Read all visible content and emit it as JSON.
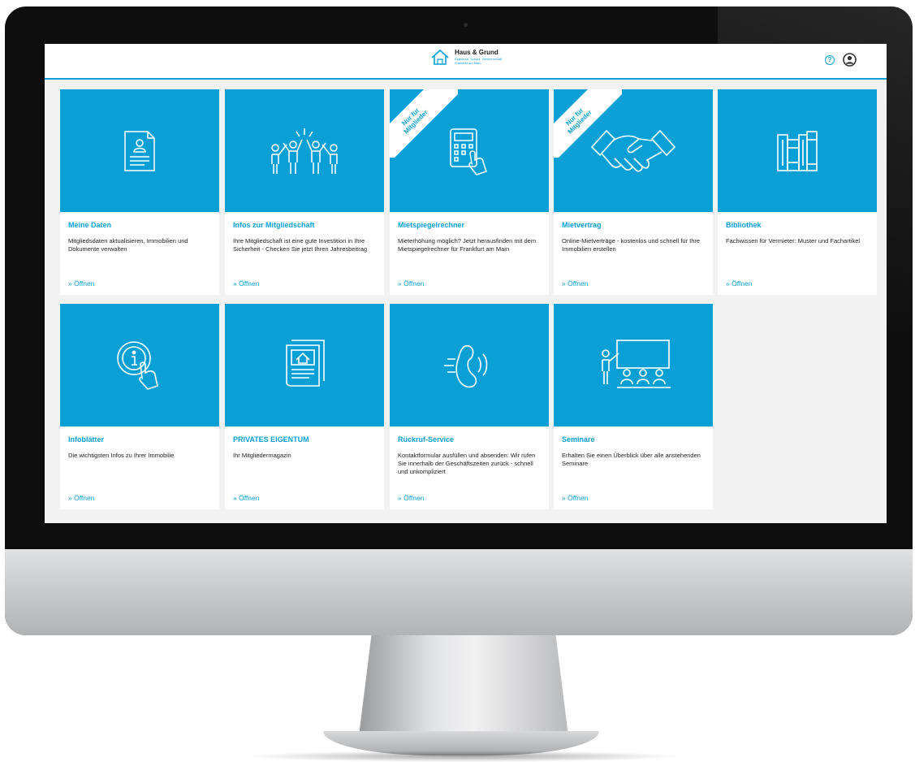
{
  "brand": {
    "name": "Haus & Grund",
    "tagline": "Eigentum. Schutz. Gemeinschaft.",
    "location": "Frankfurt am Main"
  },
  "header": {
    "help_icon": "question-circle-icon",
    "user_icon": "user-circle-icon"
  },
  "colors": {
    "accent": "#0aa0d6",
    "card_bg": "#ffffff",
    "page_bg": "#f2f2f2"
  },
  "ribbon": {
    "line1": "Nur für",
    "line2": "Mitglieder"
  },
  "cards": [
    {
      "title": "Meine Daten",
      "desc": "Mitgliedsdaten aktualisieren, Immobilien und Dokumente verwalten",
      "link": "» Öffnen",
      "icon": "member-document-icon"
    },
    {
      "title": "Infos zur Mitgliedschaft",
      "desc": "Ihre Mitgliedschaft ist eine gute Investition in Ihre Sicherheit - Checken Sie jetzt Ihren Jahresbeitrag",
      "link": "» Öffnen",
      "icon": "group-celebration-icon"
    },
    {
      "title": "Mietspiegelrechner",
      "desc": "Mieterhöhung möglich? Jetzt herausfinden mit dem Mietspiegelrechner für Frankfurt am Main",
      "link": "» Öffnen",
      "icon": "calculator-hand-icon"
    },
    {
      "title": "Mietvertrag",
      "desc": "Online-Mietverträge - kostenlos und schnell für Ihre Immobilien erstellen",
      "link": "» Öffnen",
      "icon": "handshake-icon"
    },
    {
      "title": "Bibliothek",
      "desc": "Fachwissen für Vermieter: Muster und Fachartikel",
      "link": "» Öffnen",
      "icon": "books-icon"
    },
    {
      "title": "Infoblätter",
      "desc": "Die wichtigsten Infos zu Ihrer Immobilie",
      "link": "» Öffnen",
      "icon": "info-touch-icon"
    },
    {
      "title": "PRIVATES EIGENTUM",
      "desc": "Ihr Mitgliedermagazin",
      "link": "» Öffnen",
      "icon": "magazine-icon"
    },
    {
      "title": "Rückruf-Service",
      "desc": "Kontaktformular ausfüllen und absenden: Wir rufen Sie innerhalb der Geschäftszeiten zurück - schnell und unkompliziert",
      "link": "» Öffnen",
      "icon": "phone-callback-icon"
    },
    {
      "title": "Seminare",
      "desc": "Erhalten Sie einen Überblick über alle anstehenden Seminare",
      "link": "» Öffnen",
      "icon": "seminar-presentation-icon"
    }
  ]
}
